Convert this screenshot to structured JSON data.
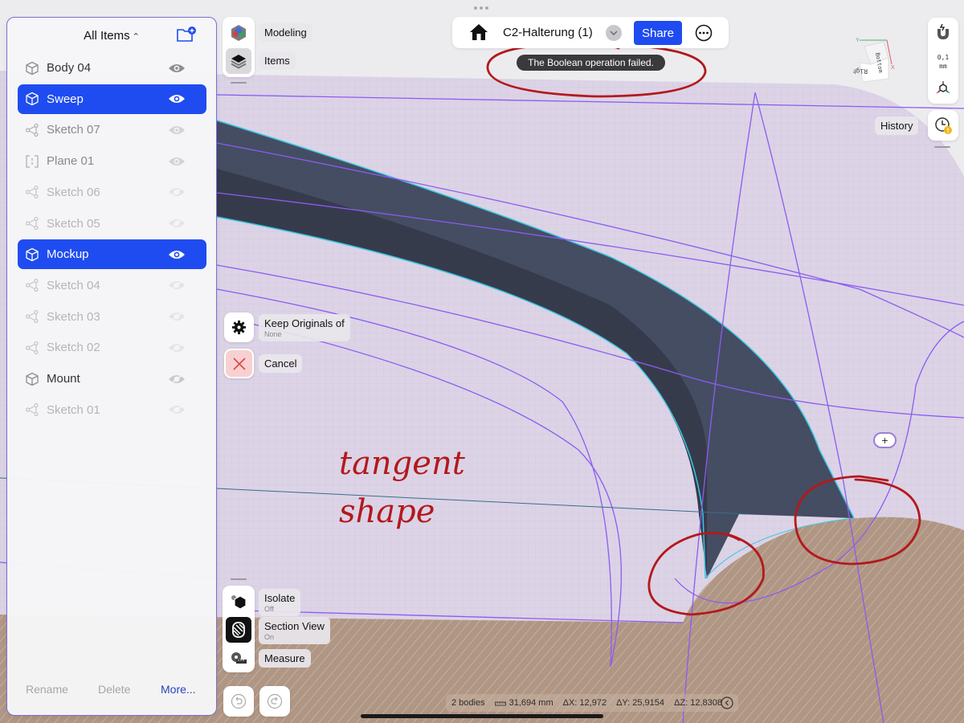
{
  "panel": {
    "title": "All Items",
    "title_chevron": "⌃⌄",
    "new_folder_icon": "folder-plus-icon",
    "items": [
      {
        "label": "Body 04",
        "type": "body",
        "state": "normal",
        "visible": true
      },
      {
        "label": "Sweep",
        "type": "body",
        "state": "selected",
        "visible": true
      },
      {
        "label": "Sketch 07",
        "type": "sketch",
        "state": "dim",
        "visible": true
      },
      {
        "label": "Plane 01",
        "type": "plane",
        "state": "dim",
        "visible": true
      },
      {
        "label": "Sketch 06",
        "type": "sketch",
        "state": "faded",
        "visible": false
      },
      {
        "label": "Sketch 05",
        "type": "sketch",
        "state": "faded",
        "visible": false
      },
      {
        "label": "Mockup",
        "type": "body",
        "state": "selected",
        "visible": true
      },
      {
        "label": "Sketch 04",
        "type": "sketch",
        "state": "faded",
        "visible": false
      },
      {
        "label": "Sketch 03",
        "type": "sketch",
        "state": "faded",
        "visible": false
      },
      {
        "label": "Sketch 02",
        "type": "sketch",
        "state": "faded",
        "visible": false
      },
      {
        "label": "Mount",
        "type": "body",
        "state": "normal",
        "visible": false
      },
      {
        "label": "Sketch 01",
        "type": "sketch",
        "state": "faded",
        "visible": false
      }
    ],
    "footer": {
      "rename": "Rename",
      "delete": "Delete",
      "more": "More..."
    }
  },
  "workspace": {
    "modeling_label": "Modeling",
    "items_label": "Items"
  },
  "operation": {
    "keep_originals_label": "Keep Originals of",
    "keep_originals_value": "None",
    "cancel_label": "Cancel"
  },
  "view_tools": {
    "isolate_label": "Isolate",
    "isolate_value": "Off",
    "section_label": "Section View",
    "section_value": "On",
    "measure_label": "Measure"
  },
  "topbar": {
    "document_title": "C2-Halterung (1)",
    "share_label": "Share",
    "toast": "The Boolean operation failed."
  },
  "right_tools": {
    "snap_value": "0,1",
    "snap_unit": "mm",
    "history_label": "History",
    "view_cube": {
      "top": "Bottom",
      "front": "Right",
      "axis_y": "Y",
      "axis_x": "X"
    }
  },
  "status": {
    "bodies": "2 bodies",
    "length": "31,694 mm",
    "dx": "ΔX: 12,972",
    "dy": "ΔY: 25,9154",
    "dz": "ΔZ: 12,8308"
  },
  "annotations": {
    "handwritten_line1": "tangent",
    "handwritten_line2": "shape",
    "ink_color": "#b3191c"
  },
  "colors": {
    "accent": "#1f4cf0",
    "sketch_line": "#8b5cf0",
    "edge_highlight": "#38c6e0",
    "sweep_body": "#454d63",
    "section_fill": "#b39a88",
    "surface": "#dcd3e6"
  }
}
